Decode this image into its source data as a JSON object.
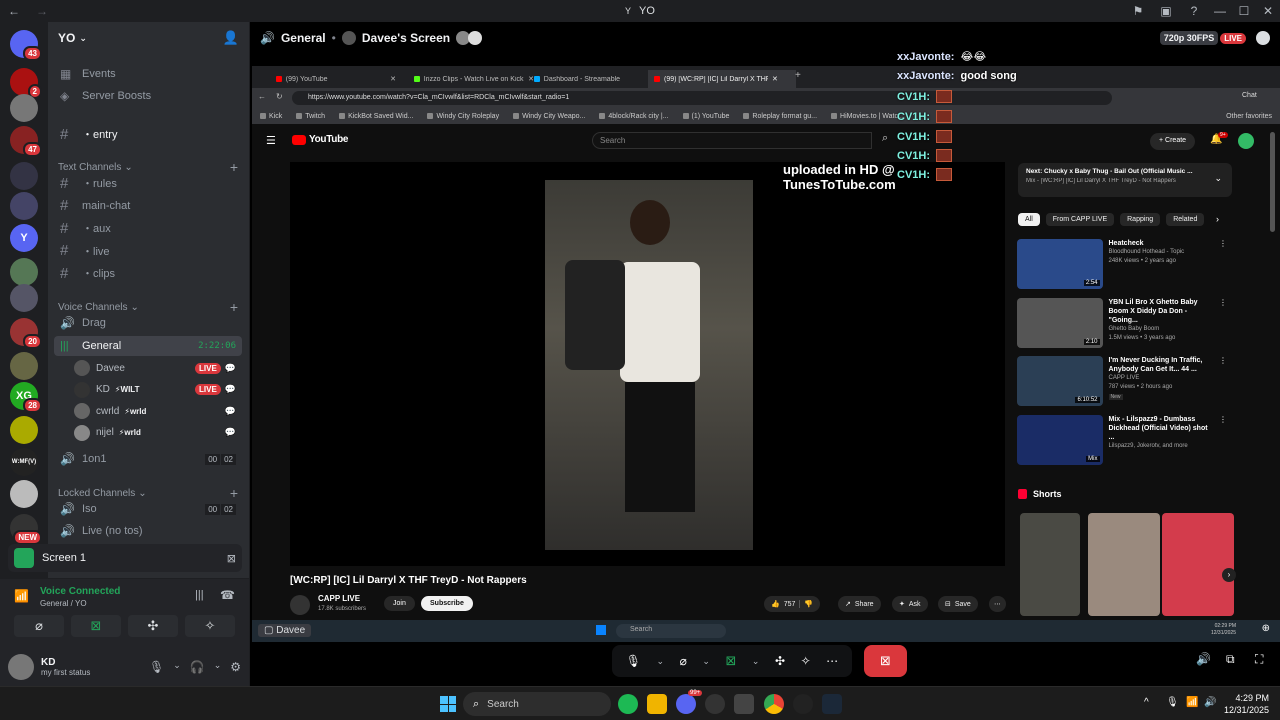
{
  "window": {
    "title": "YO"
  },
  "servers": [
    {
      "badge": "43",
      "color": "#5865f2"
    },
    {
      "badge": "2",
      "color": "#a11"
    },
    {
      "badge": "",
      "color": "#777"
    },
    {
      "badge": "47",
      "color": "#822"
    },
    {
      "badge": "",
      "color": "#334"
    },
    {
      "badge": "",
      "color": "#446"
    },
    {
      "badge": "",
      "color": "#5865f2",
      "letter": "Y"
    },
    {
      "badge": "",
      "color": "#575"
    },
    {
      "badge": "",
      "color": "#556"
    },
    {
      "badge": "20",
      "color": "#933"
    },
    {
      "badge": "",
      "color": "#664"
    },
    {
      "badge": "28",
      "color": "#2a2",
      "letter": "XG"
    },
    {
      "badge": "",
      "color": "#aa0"
    },
    {
      "badge": "",
      "color": "#222",
      "letter": "W:MF(V)"
    },
    {
      "badge": "",
      "color": "#bbb"
    },
    {
      "badge": "NEW",
      "color": "#333"
    }
  ],
  "server": {
    "name": "YO"
  },
  "channels": {
    "events": "Events",
    "boosts": "Server Boosts",
    "entry": "・entry",
    "text_category": "Text Channels",
    "text": [
      "・rules",
      "main-chat",
      "・aux",
      "・live",
      "・clips"
    ],
    "voice_category": "Voice Channels",
    "drag": "Drag",
    "general": "General",
    "general_time": "2:22:06",
    "users": [
      {
        "name": "Davee",
        "tag": "",
        "live": "LIVE"
      },
      {
        "name": "KD",
        "tag": "WILT",
        "live": "LIVE"
      },
      {
        "name": "cwrld",
        "tag": "wrld",
        "live": ""
      },
      {
        "name": "nijel",
        "tag": "wrld",
        "live": ""
      }
    ],
    "oneonone": "1on1",
    "oneonone_count": [
      "00",
      "02"
    ],
    "locked_category": "Locked Channels",
    "iso": "Iso",
    "iso_count": [
      "00",
      "02"
    ],
    "live_no_tos": "Live (no tos)"
  },
  "screen_share": {
    "label": "Screen 1"
  },
  "voice": {
    "status": "Voice Connected",
    "location": "General / YO"
  },
  "user": {
    "name": "KD",
    "status": "my first status"
  },
  "stream": {
    "channel": "General",
    "screen_owner": "Davee's Screen",
    "quality": "720p 30FPS",
    "live": "LIVE",
    "watcher_label": "Davee"
  },
  "browser": {
    "tabs": [
      "(99) YouTube",
      "Irizzo Clips - Watch Live on Kick",
      "Dashboard - Streamable",
      "(99) [WC:RP] [IC] Lil Darryl X THF T..."
    ],
    "url": "https://www.youtube.com/watch?v=Cla_mCIvwlf&list=RDCla_mCIvwlf&start_radio=1",
    "favorites": [
      "Kick",
      "Twitch",
      "KickBot Saved Wid...",
      "Windy City Roleplay",
      "Windy City Weapo...",
      "4block/Rack city |...",
      "(1) YouTube",
      "Roleplay format gu...",
      "HiMovies.to | Watc..."
    ],
    "other_favorites": "Other favorites",
    "chat_label": "Chat"
  },
  "youtube": {
    "logo": "YouTube",
    "search_placeholder": "Search",
    "create": "Create",
    "notif_badge": "9+",
    "overlay_text": "uploaded in HD @ TunesToTube.com",
    "video_title": "[WC:RP] [IC] Lil Darryl X THF TreyD - Not Rappers",
    "channel": "CAPP LIVE",
    "subscribers": "17.8K subscribers",
    "join": "Join",
    "subscribe": "Subscribe",
    "likes": "757",
    "share": "Share",
    "ask": "Ask",
    "save": "Save",
    "next_label": "Next: Chucky x Baby Thug - Bail Out (Official Music ...",
    "next_sub": "Mix - [WC:RP] [IC] Lil Darryl X THF TreyD - Not Rappers",
    "chips": [
      "All",
      "From CAPP LIVE",
      "Rapping",
      "Related"
    ],
    "recommended": [
      {
        "title": "Heatcheck",
        "channel": "Bloodhound Hothead - Topic",
        "meta": "248K views • 2 years ago",
        "duration": "2:54",
        "color": "#2a4a8a"
      },
      {
        "title": "YBN Lil Bro X Ghetto Baby Boom X Diddy Da Don - \"Going...",
        "channel": "Ghetto Baby Boom",
        "meta": "1.5M views • 3 years ago",
        "duration": "2:10",
        "color": "#555"
      },
      {
        "title": "I'm Never Ducking In Traffic, Anybody Can Get It... 44 ...",
        "channel": "CAPP LIVE",
        "meta": "787 views • 2 hours ago",
        "duration": "6:10:52",
        "color": "#2b3f55",
        "badge": "New"
      },
      {
        "title": "Mix - Lilspazz9 - Dumbass Dickhead (Official Video) shot ...",
        "channel": "Lilspazz9, Jokerotv, and more",
        "meta": "",
        "duration": "Mix",
        "color": "#1a2c66"
      }
    ],
    "shorts_label": "Shorts"
  },
  "chat": [
    {
      "name": "xxJavonte:",
      "msg": "😂😂"
    },
    {
      "name": "xxJavonte:",
      "msg": "good song"
    },
    {
      "name": "CV1H:",
      "msg": ""
    },
    {
      "name": "CV1H:",
      "msg": ""
    },
    {
      "name": "CV1H:",
      "msg": ""
    },
    {
      "name": "CV1H:",
      "msg": ""
    },
    {
      "name": "CV1H:",
      "msg": ""
    }
  ],
  "inner_taskbar": {
    "search": "Search",
    "time": "02:29 PM",
    "date": "12/31/2025"
  },
  "taskbar": {
    "search": "Search",
    "time": "4:29 PM",
    "date": "12/31/2025",
    "badge": "99+"
  }
}
